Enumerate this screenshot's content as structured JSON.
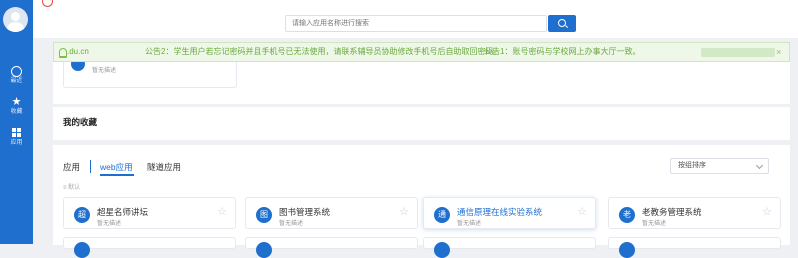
{
  "sidebar": {
    "items": [
      {
        "label": "最近",
        "icon": "clock-icon"
      },
      {
        "label": "收藏",
        "icon": "star-icon"
      },
      {
        "label": "应用",
        "icon": "grid-icon"
      }
    ]
  },
  "search": {
    "placeholder": "请输入应用名称进行搜索"
  },
  "notice": {
    "domain": ".du.cn",
    "notice2": "公告2：学生用户若忘记密码并且手机号已无法使用，请联系辅导员协助修改手机号后自助取回密码。",
    "notice1": "公告1：账号密码与学校网上办事大厅一致。",
    "close": "×"
  },
  "recent": {
    "desc": "暂无描述"
  },
  "favorites": {
    "title": "我的收藏"
  },
  "apps": {
    "tabs": [
      "应用",
      "web应用",
      "隧道应用"
    ],
    "sort": "按组排序",
    "group_label": "默认",
    "cards": [
      {
        "initial": "超",
        "name": "超星名师讲坛",
        "desc": "暂无描述"
      },
      {
        "initial": "图",
        "name": "图书管理系统",
        "desc": "暂无描述"
      },
      {
        "initial": "通",
        "name": "通信原理在线实验系统",
        "desc": "暂无描述"
      },
      {
        "initial": "老",
        "name": "老教务管理系统",
        "desc": "暂无描述"
      }
    ]
  },
  "colors": {
    "primary": "#1e6fce",
    "notice_text": "#6aaa3e",
    "notice_bg": "#eef7e8"
  }
}
